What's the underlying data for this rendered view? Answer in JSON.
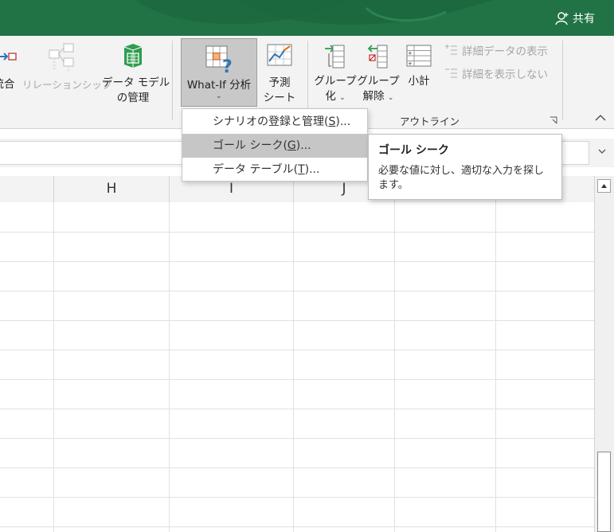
{
  "titlebar": {
    "share_label": "共有",
    "color": "#217346"
  },
  "ribbon": {
    "consolidate_label": "統合",
    "relationships_label": "リレーションシップ",
    "data_model_line1": "データ モデル",
    "data_model_line2": "の管理",
    "whatif_label": "What-If 分析",
    "forecast_line1": "予測",
    "forecast_line2": "シート",
    "group_line1": "グループ",
    "group_line2": "化",
    "ungroup_line1": "グループ",
    "ungroup_line2": "解除",
    "subtotal_label": "小計",
    "show_detail_label": "詳細データの表示",
    "hide_detail_label": "詳細を表示しない",
    "outline_group_label": "アウトライン"
  },
  "whatif_menu": {
    "items": [
      {
        "label": "シナリオの登録と管理(",
        "key": "S",
        "suffix": ")..."
      },
      {
        "label": "ゴール シーク(",
        "key": "G",
        "suffix": ")..."
      },
      {
        "label": "データ テーブル(",
        "key": "T",
        "suffix": ")..."
      }
    ],
    "highlighted_index": 1
  },
  "tooltip": {
    "title": "ゴール シーク",
    "body": "必要な値に対し、適切な入力を探します。"
  },
  "columns": [
    "H",
    "I",
    "J"
  ],
  "colors": {
    "accent": "#217346",
    "hover": "#c6c6c6",
    "icon_green": "#2e9d4e",
    "icon_blue": "#2f75b5"
  }
}
